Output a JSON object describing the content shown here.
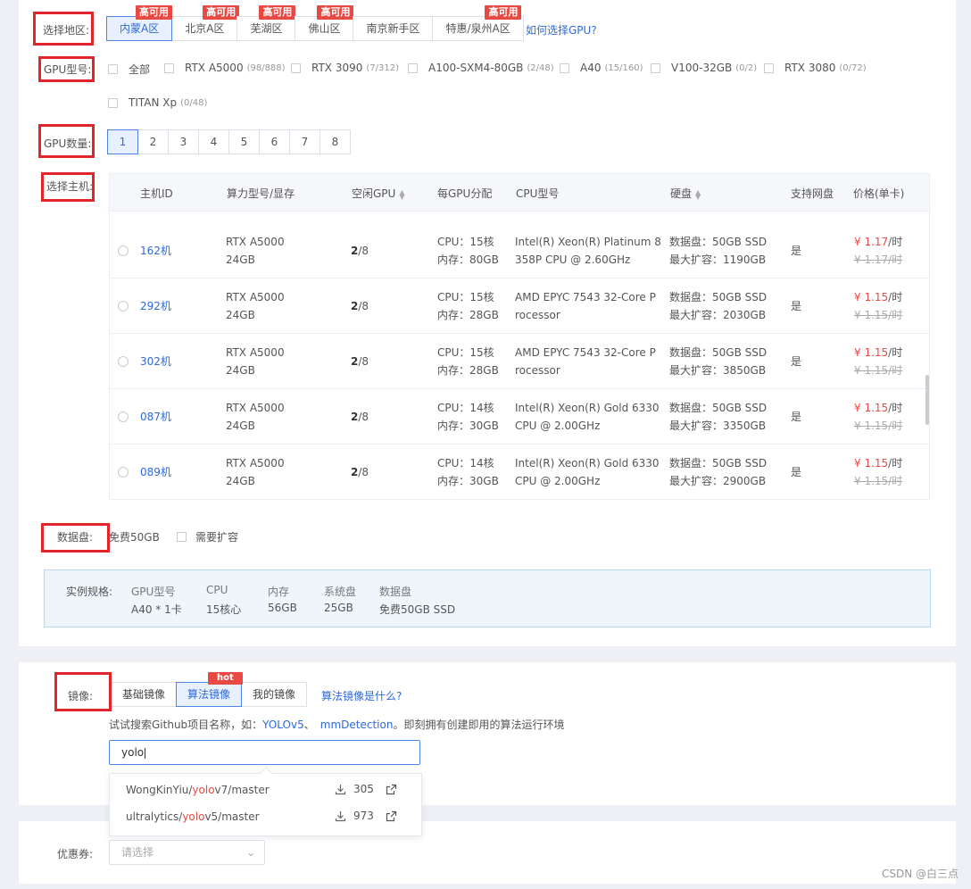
{
  "region": {
    "label": "选择地区:",
    "options": [
      {
        "label": "内蒙A区",
        "badge": "高可用",
        "active": true
      },
      {
        "label": "北京A区",
        "badge": "高可用",
        "active": false
      },
      {
        "label": "芜湖区",
        "badge": "高可用",
        "active": false
      },
      {
        "label": "佛山区",
        "badge": "高可用",
        "active": false
      },
      {
        "label": "南京新手区",
        "badge": "",
        "active": false
      },
      {
        "label": "特惠/泉州A区",
        "badge": "高可用",
        "active": false
      }
    ],
    "help_link": "如何选择GPU?"
  },
  "gpu_type": {
    "label": "GPU型号:",
    "options": [
      {
        "label": "全部",
        "count": ""
      },
      {
        "label": "RTX A5000",
        "count": "(98/888)"
      },
      {
        "label": "RTX 3090",
        "count": "(7/312)"
      },
      {
        "label": "A100-SXM4-80GB",
        "count": "(2/48)"
      },
      {
        "label": "A40",
        "count": "(15/160)"
      },
      {
        "label": "V100-32GB",
        "count": "(0/2)"
      },
      {
        "label": "RTX 3080",
        "count": "(0/72)"
      },
      {
        "label": "TITAN Xp",
        "count": "(0/48)"
      }
    ]
  },
  "gpu_count": {
    "label": "GPU数量:",
    "options": [
      "1",
      "2",
      "3",
      "4",
      "5",
      "6",
      "7",
      "8"
    ],
    "selected": "1"
  },
  "host": {
    "label": "选择主机:",
    "columns": {
      "id": "主机ID",
      "model": "算力型号/显存",
      "free": "空闲GPU",
      "per_gpu": "每GPU分配",
      "cpu": "CPU型号",
      "disk": "硬盘",
      "netdisk": "支持网盘",
      "price": "价格(单卡)"
    },
    "rows": [
      {
        "id": "162机",
        "model": "RTX A5000",
        "vram": "24GB",
        "free": "2",
        "total": "/8",
        "cpu_alloc": "CPU：15核",
        "mem_alloc": "内存：80GB",
        "cpu1": "Intel(R) Xeon(R) Platinum 8",
        "cpu2": "358P CPU @ 2.60GHz",
        "disk1": "数据盘：50GB SSD",
        "disk2": "最大扩容：1190GB",
        "netdisk": "是",
        "price": "¥ 1.17",
        "unit": "/时",
        "old": "¥ 1.17/时"
      },
      {
        "id": "292机",
        "model": "RTX A5000",
        "vram": "24GB",
        "free": "2",
        "total": "/8",
        "cpu_alloc": "CPU：15核",
        "mem_alloc": "内存：28GB",
        "cpu1": "AMD EPYC 7543 32-Core P",
        "cpu2": "rocessor",
        "disk1": "数据盘：50GB SSD",
        "disk2": "最大扩容：2030GB",
        "netdisk": "是",
        "price": "¥ 1.15",
        "unit": "/时",
        "old": "¥ 1.15/时"
      },
      {
        "id": "302机",
        "model": "RTX A5000",
        "vram": "24GB",
        "free": "2",
        "total": "/8",
        "cpu_alloc": "CPU：15核",
        "mem_alloc": "内存：28GB",
        "cpu1": "AMD EPYC 7543 32-Core P",
        "cpu2": "rocessor",
        "disk1": "数据盘：50GB SSD",
        "disk2": "最大扩容：3850GB",
        "netdisk": "是",
        "price": "¥ 1.15",
        "unit": "/时",
        "old": "¥ 1.15/时"
      },
      {
        "id": "087机",
        "model": "RTX A5000",
        "vram": "24GB",
        "free": "2",
        "total": "/8",
        "cpu_alloc": "CPU：14核",
        "mem_alloc": "内存：30GB",
        "cpu1": "Intel(R) Xeon(R) Gold 6330",
        "cpu2": "CPU @ 2.00GHz",
        "disk1": "数据盘：50GB SSD",
        "disk2": "最大扩容：3350GB",
        "netdisk": "是",
        "price": "¥ 1.15",
        "unit": "/时",
        "old": "¥ 1.15/时"
      },
      {
        "id": "089机",
        "model": "RTX A5000",
        "vram": "24GB",
        "free": "2",
        "total": "/8",
        "cpu_alloc": "CPU：14核",
        "mem_alloc": "内存：30GB",
        "cpu1": "Intel(R) Xeon(R) Gold 6330",
        "cpu2": "CPU @ 2.00GHz",
        "disk1": "数据盘：50GB SSD",
        "disk2": "最大扩容：2900GB",
        "netdisk": "是",
        "price": "¥ 1.15",
        "unit": "/时",
        "old": "¥ 1.15/时"
      }
    ]
  },
  "data_disk": {
    "label": "数据盘:",
    "free": "免费50GB",
    "expand": "需要扩容"
  },
  "spec": {
    "label": "实例规格:",
    "items": [
      {
        "k": "GPU型号",
        "v": "A40 * 1卡"
      },
      {
        "k": "CPU",
        "v": "15核心"
      },
      {
        "k": "内存",
        "v": "56GB"
      },
      {
        "k": "系统盘",
        "v": "25GB"
      },
      {
        "k": "数据盘",
        "v": "免费50GB SSD"
      }
    ]
  },
  "image": {
    "label": "镜像:",
    "tabs": [
      {
        "label": "基础镜像",
        "active": false,
        "badge": ""
      },
      {
        "label": "算法镜像",
        "active": true,
        "badge": "hot"
      },
      {
        "label": "我的镜像",
        "active": false,
        "badge": ""
      }
    ],
    "help_link": "算法镜像是什么?",
    "hint_pre": "试试搜索Github项目名称，如：",
    "hint_link1": "YOLOv5",
    "hint_sep": "、",
    "hint_link2": "mmDetection",
    "hint_post": "。即刻拥有创建即用的算法运行环境",
    "search_value": "yolo",
    "suggestions": [
      {
        "pre": "WongKinYiu/",
        "hl": "yolo",
        "post": "v7/master",
        "downloads": "305"
      },
      {
        "pre": "ultralytics/",
        "hl": "yolo",
        "post": "v5/master",
        "downloads": "973"
      }
    ]
  },
  "coupon": {
    "label": "优惠券:",
    "placeholder": "请选择"
  },
  "watermark": "CSDN @白三点",
  "colors": {
    "accent": "#2f6ad8",
    "highlight": "#e3242b",
    "price": "#e84a43"
  }
}
